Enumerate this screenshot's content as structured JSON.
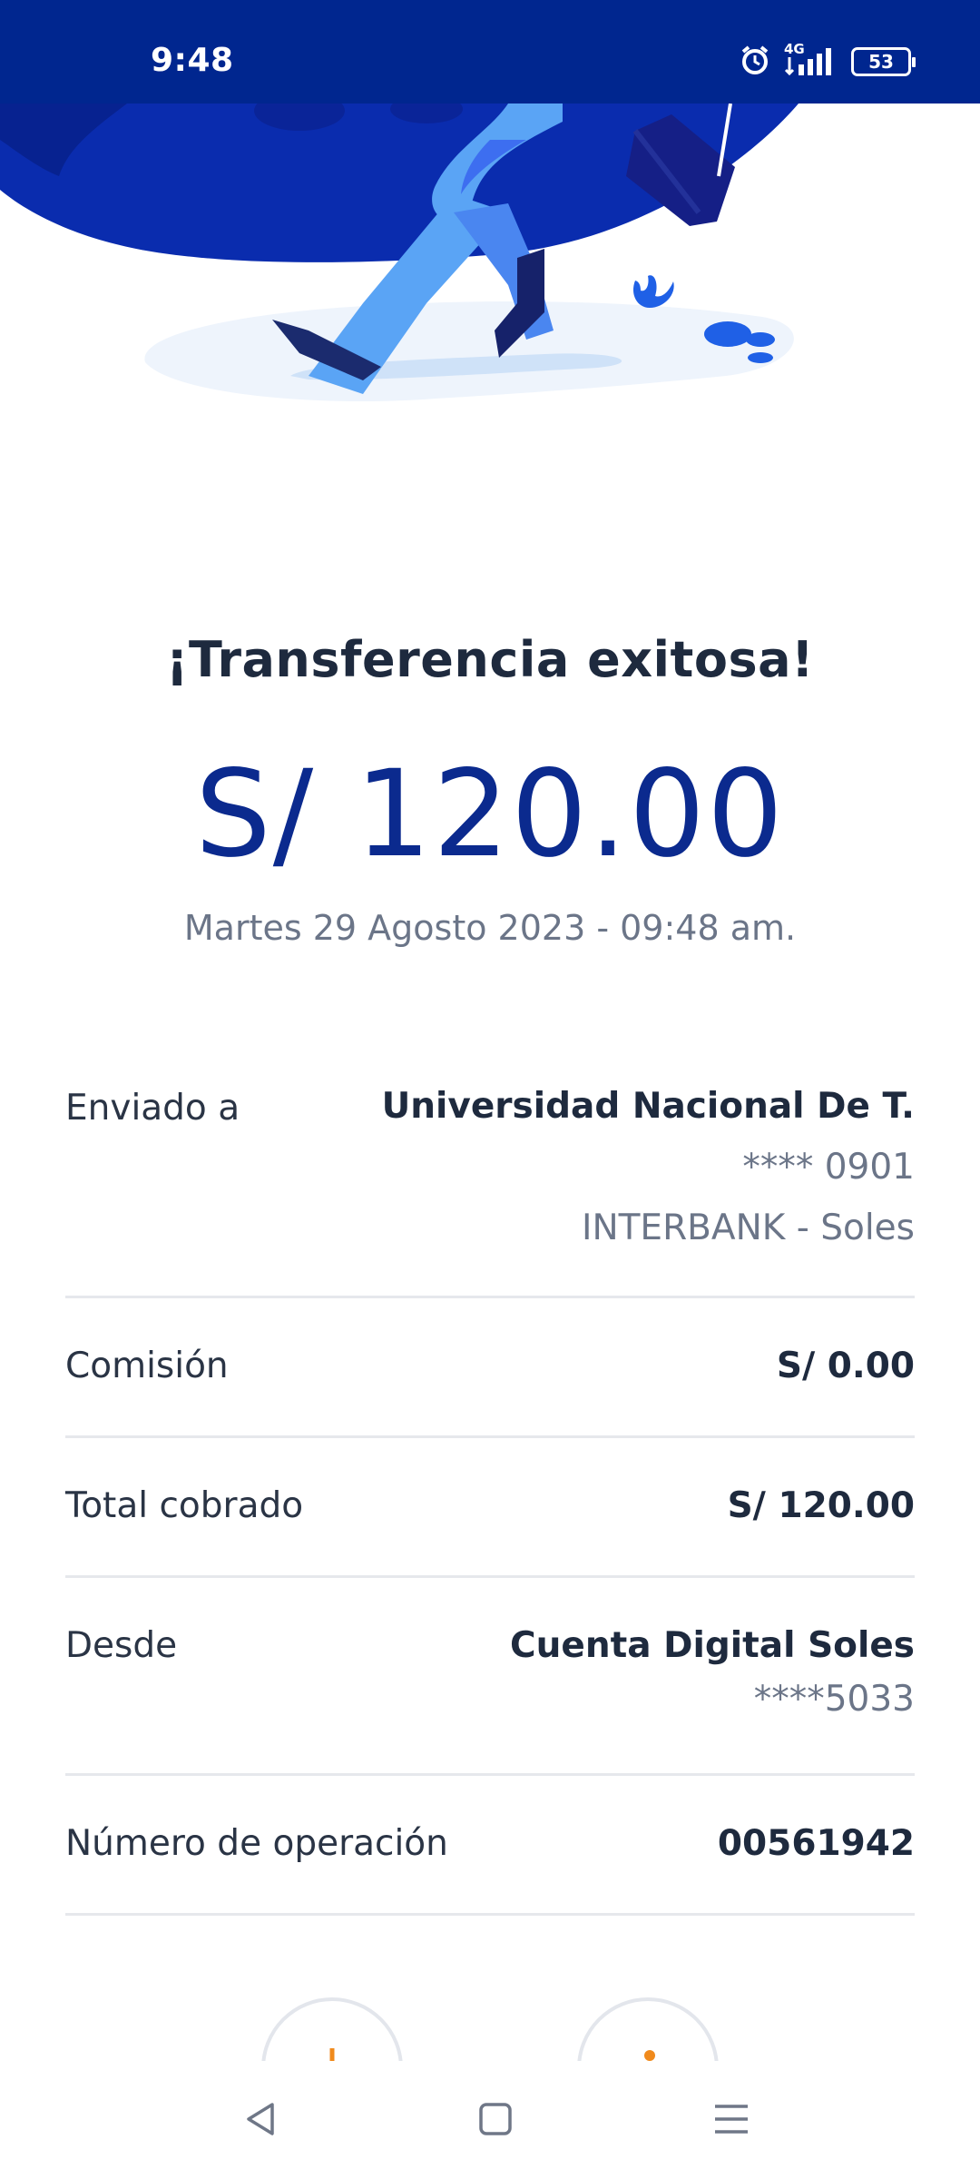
{
  "status_bar": {
    "time": "9:48",
    "network": "4G",
    "battery": "53",
    "icons": [
      "alarm-icon",
      "signal-icon",
      "battery-icon"
    ]
  },
  "illustration": "person-walking-icon",
  "header": {
    "title": "¡Transferencia exitosa!",
    "amount": "S/ 120.00",
    "datetime": "Martes 29 Agosto 2023 - 09:48 am."
  },
  "details": {
    "sent_to": {
      "label": "Enviado a",
      "name": "Universidad Nacional De T.",
      "account": "**** 0901",
      "bank": "INTERBANK - Soles"
    },
    "commission": {
      "label": "Comisión",
      "value": "S/ 0.00"
    },
    "total": {
      "label": "Total cobrado",
      "value": "S/ 120.00"
    },
    "from": {
      "label": "Desde",
      "account_name": "Cuenta Digital Soles",
      "account_number": "****5033"
    },
    "operation": {
      "label": "Número de operación",
      "value": "00561942"
    }
  },
  "actions": [
    "download-icon",
    "share-icon"
  ],
  "nav": [
    "back-icon",
    "home-icon",
    "menu-icon"
  ],
  "colors": {
    "brand_blue": "#00268f",
    "amount_blue": "#0b2a8e",
    "accent_orange": "#f08a1c"
  }
}
